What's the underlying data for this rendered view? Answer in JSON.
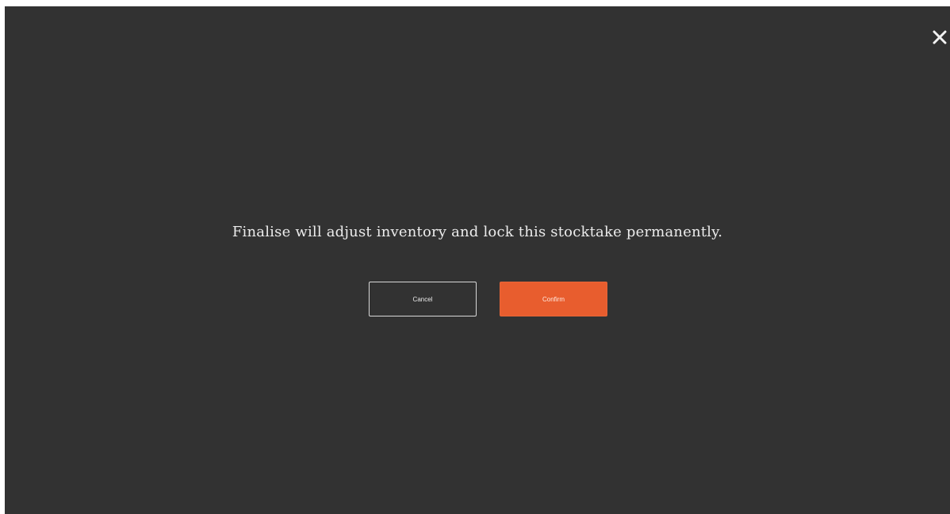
{
  "dialog": {
    "message": "Finalise will adjust inventory and lock this stocktake permanently.",
    "cancel_label": "Cancel",
    "confirm_label": "Confirm",
    "close_icon": "close-icon"
  },
  "colors": {
    "overlay_background": "#323232",
    "accent": "#e85d2e",
    "text": "#ececec"
  }
}
